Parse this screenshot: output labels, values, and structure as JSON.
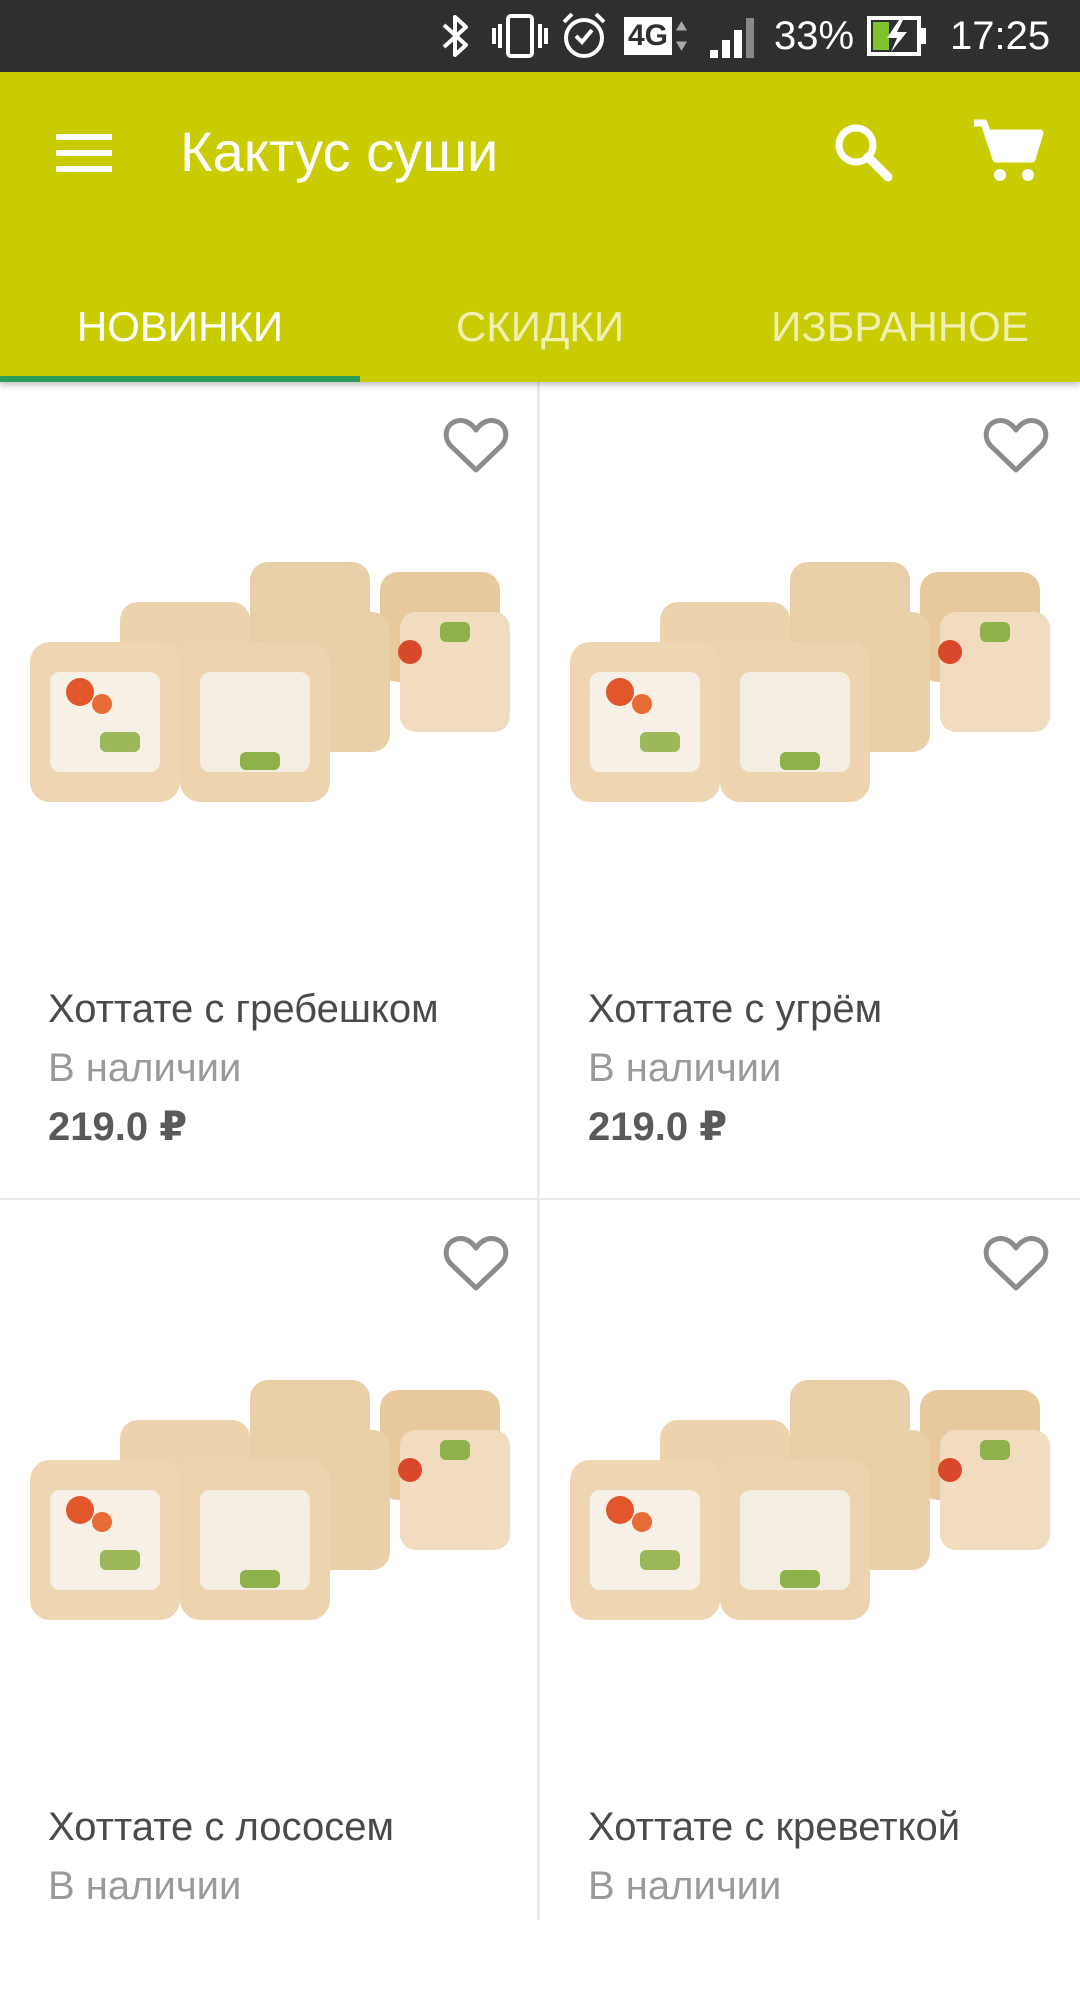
{
  "status_bar": {
    "battery": "33%",
    "time": "17:25",
    "network": "4G",
    "icons": [
      "bluetooth-icon",
      "vibrate-icon",
      "alarm-icon",
      "network-4g-icon",
      "signal-icon",
      "battery-charging-icon"
    ]
  },
  "app_bar": {
    "title": "Кактус суши",
    "color": "#c9cc00",
    "icons": [
      "menu-icon",
      "search-icon",
      "cart-icon"
    ]
  },
  "tabs": [
    {
      "label": "НОВИНКИ",
      "active": true
    },
    {
      "label": "СКИДКИ",
      "active": false
    },
    {
      "label": "ИЗБРАННОЕ",
      "active": false
    }
  ],
  "accent_color": "#2e9d5a",
  "products": [
    {
      "name": "Хоттате с гребешком",
      "availability": "В наличии",
      "price": "219.0 ₽"
    },
    {
      "name": "Хоттате с угрём",
      "availability": "В наличии",
      "price": "219.0 ₽"
    },
    {
      "name": "Хоттате с лососем",
      "availability": "В наличии",
      "price": ""
    },
    {
      "name": "Хоттате с креветкой",
      "availability": "В наличии",
      "price": ""
    }
  ]
}
